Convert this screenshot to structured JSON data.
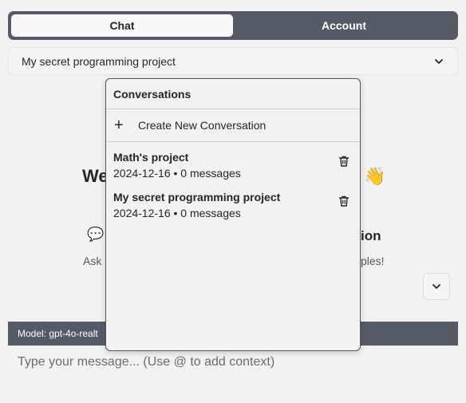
{
  "tabs": [
    {
      "label": "Chat",
      "active": true
    },
    {
      "label": "Account",
      "active": false
    }
  ],
  "selector": {
    "value": "My secret programming project",
    "icon": "chevron-down-icon"
  },
  "welcome": {
    "title_left": "We",
    "wave_emoji": "👋",
    "bubble_emoji": "💬",
    "feature_tail": "ion",
    "ask_left": "Ask",
    "ask_right": "ples!"
  },
  "scroll_button": {
    "icon": "chevron-down-icon"
  },
  "model_bar": {
    "text": "Model: gpt-4o-realt"
  },
  "composer": {
    "placeholder": "Type your message... (Use @ to add context)"
  },
  "conversations_menu": {
    "header": "Conversations",
    "create_label": "Create New Conversation",
    "create_icon": "+",
    "items": [
      {
        "title": "Math's project",
        "date": "2024-12-16",
        "count": "0 messages",
        "meta": "2024-12-16 • 0 messages"
      },
      {
        "title": "My secret programming project",
        "date": "2024-12-16",
        "count": "0 messages",
        "meta": "2024-12-16 • 0 messages"
      }
    ]
  },
  "colors": {
    "bar": "#545b66",
    "background": "#f2f2f2"
  }
}
